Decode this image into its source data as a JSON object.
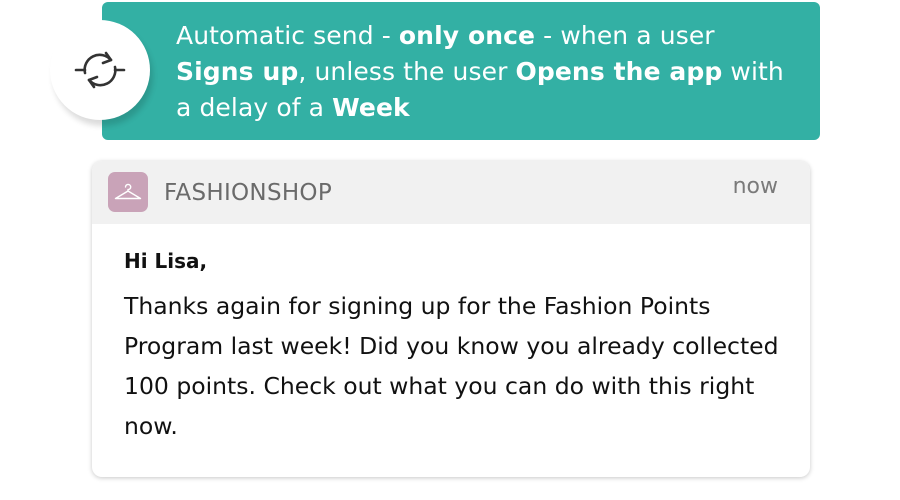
{
  "trigger": {
    "t1": "Automatic send - ",
    "t2": "only once",
    "t3": " - when a user ",
    "t4": "Signs up",
    "t5": ", unless the user ",
    "t6": "Opens the app",
    "t7": " with a delay of a ",
    "t8": "Week",
    "icon": "sync-arrows-icon",
    "color": "#33b0a4"
  },
  "notification": {
    "app_name": "FASHIONSHOP",
    "app_icon": "hanger-icon",
    "app_icon_color": "#c9a3b8",
    "time": "now",
    "greeting": "Hi Lisa,",
    "message": "Thanks again for signing up for the Fashion Points Program last week! Did you know you already collected 100 points. Check out what you can do with this right now."
  }
}
